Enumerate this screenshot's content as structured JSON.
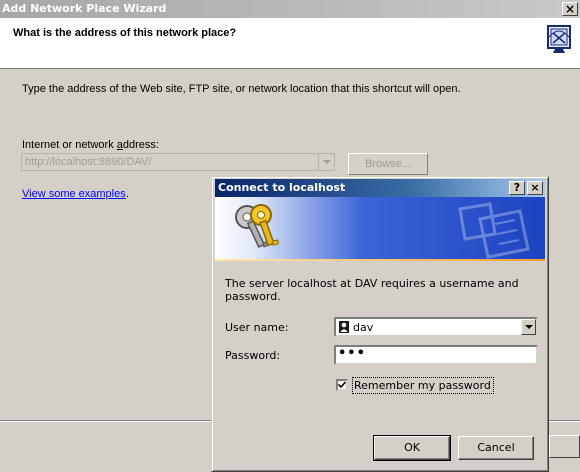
{
  "wizard": {
    "title": "Add Network Place Wizard",
    "close_glyph": "×",
    "heading": "What is the address of this network place?",
    "header_icon": "network-place-icon",
    "instruction": "Type the address of the Web site, FTP site, or network location that this shortcut will open.",
    "address_label_pre": "Internet or network ",
    "address_label_underlined": "a",
    "address_label_post": "ddress:",
    "address_value": "http://localhost:8890/DAV/",
    "browse_label": "Browse...",
    "examples_link": "View some examples",
    "examples_link_suffix": "."
  },
  "dialog": {
    "title": "Connect to localhost",
    "help_glyph": "?",
    "close_glyph": "×",
    "banner_icon": "keys-icon",
    "message": "The server localhost at DAV requires a username and password.",
    "username_label": "User name:",
    "username_value": "dav",
    "password_label": "Password:",
    "password_value": "•••",
    "remember_label": "Remember my password",
    "remember_checked": true,
    "ok_label": "OK",
    "cancel_label": "Cancel"
  },
  "colors": {
    "dialog_title_start": "#0a246a",
    "dialog_title_end": "#a6caf0",
    "link": "#0000ff",
    "face": "#d4d0c8"
  }
}
